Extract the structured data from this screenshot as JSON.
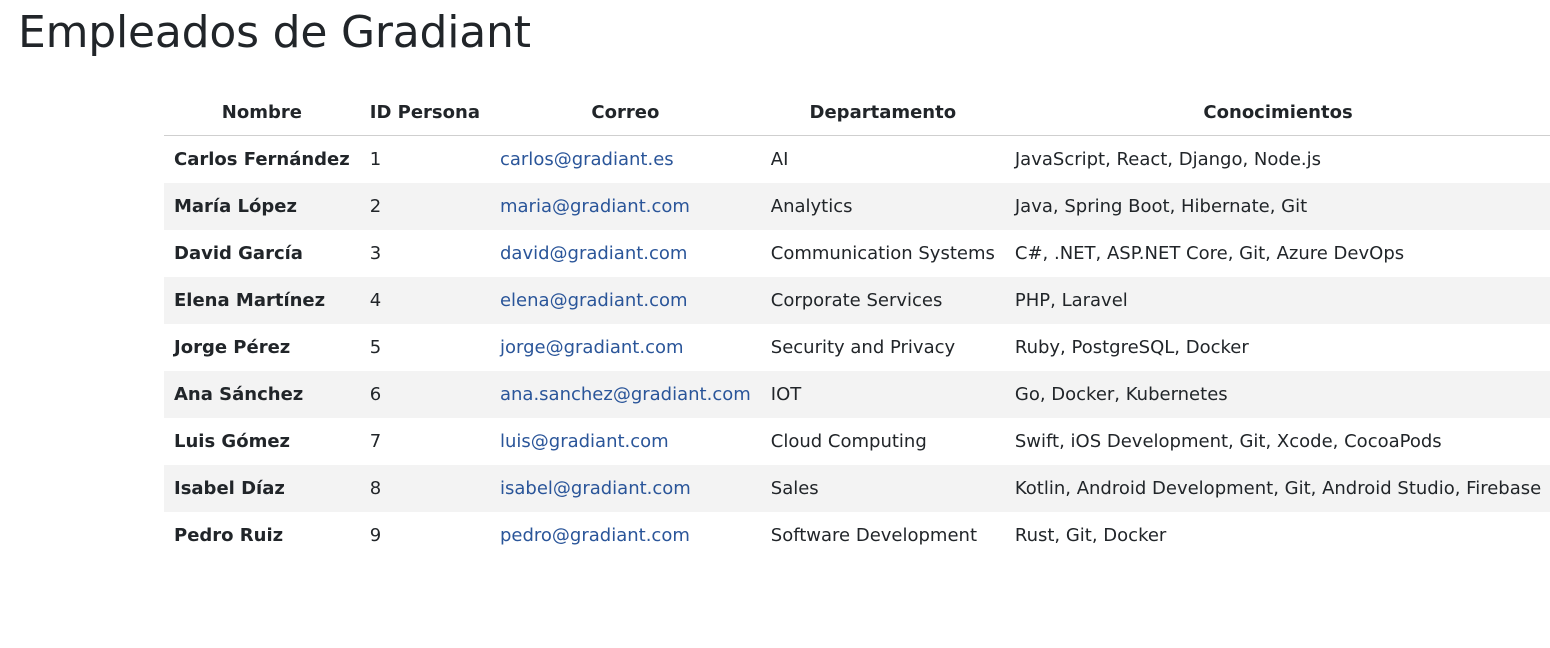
{
  "page": {
    "title": "Empleados de Gradiant"
  },
  "table": {
    "headers": [
      "Nombre",
      "ID Persona",
      "Correo",
      "Departamento",
      "Conocimientos"
    ],
    "rows": [
      {
        "nombre": "Carlos Fernández",
        "id": "1",
        "correo": "carlos@gradiant.es",
        "departamento": "AI",
        "conocimientos": "JavaScript, React, Django, Node.js"
      },
      {
        "nombre": "María López",
        "id": "2",
        "correo": "maria@gradiant.com",
        "departamento": "Analytics",
        "conocimientos": "Java, Spring Boot, Hibernate, Git"
      },
      {
        "nombre": "David García",
        "id": "3",
        "correo": "david@gradiant.com",
        "departamento": "Communication Systems",
        "conocimientos": "C#, .NET, ASP.NET Core, Git, Azure DevOps"
      },
      {
        "nombre": "Elena Martínez",
        "id": "4",
        "correo": "elena@gradiant.com",
        "departamento": "Corporate Services",
        "conocimientos": "PHP, Laravel"
      },
      {
        "nombre": "Jorge Pérez",
        "id": "5",
        "correo": "jorge@gradiant.com",
        "departamento": "Security and Privacy",
        "conocimientos": "Ruby, PostgreSQL, Docker"
      },
      {
        "nombre": "Ana Sánchez",
        "id": "6",
        "correo": "ana.sanchez@gradiant.com",
        "departamento": "IOT",
        "conocimientos": "Go, Docker, Kubernetes"
      },
      {
        "nombre": "Luis Gómez",
        "id": "7",
        "correo": "luis@gradiant.com",
        "departamento": "Cloud Computing",
        "conocimientos": "Swift, iOS Development, Git, Xcode, CocoaPods"
      },
      {
        "nombre": "Isabel Díaz",
        "id": "8",
        "correo": "isabel@gradiant.com",
        "departamento": "Sales",
        "conocimientos": "Kotlin, Android Development, Git, Android Studio, Firebase"
      },
      {
        "nombre": "Pedro Ruiz",
        "id": "9",
        "correo": "pedro@gradiant.com",
        "departamento": "Software Development",
        "conocimientos": "Rust, Git, Docker"
      }
    ]
  },
  "colors": {
    "link": "#2a5599",
    "stripe": "#f3f3f3",
    "text": "#212529",
    "header_rule": "#cfcfcf"
  }
}
